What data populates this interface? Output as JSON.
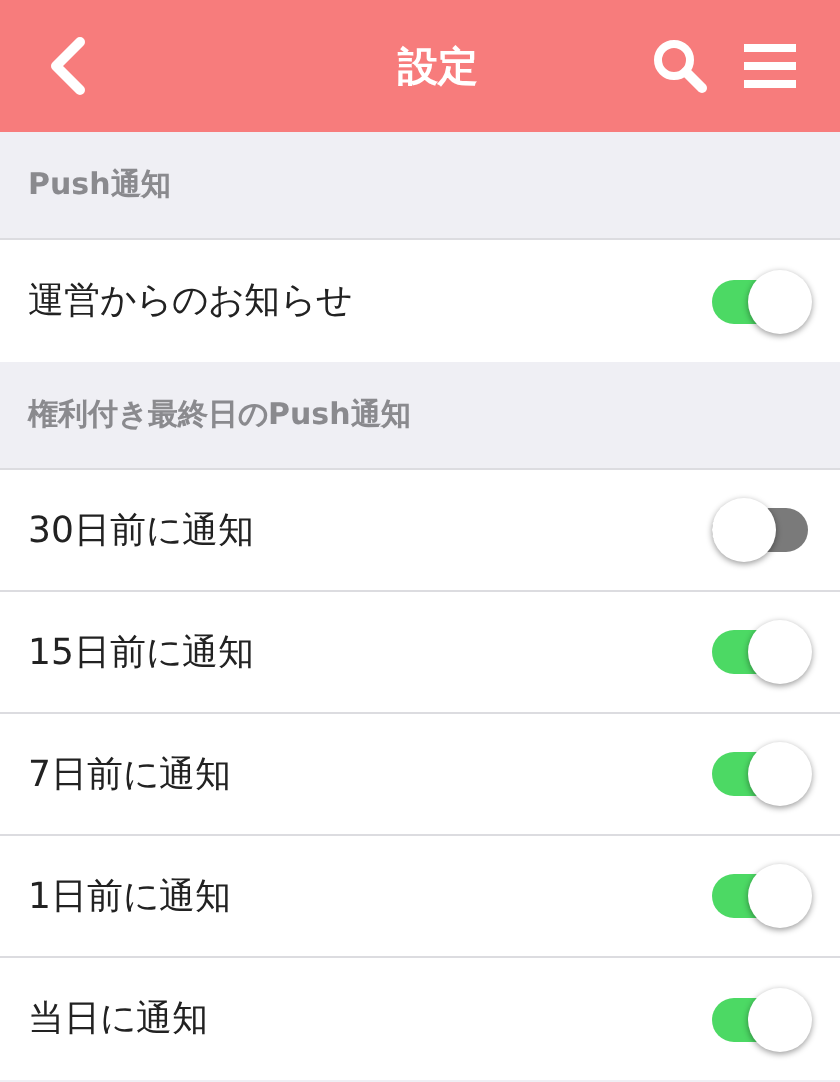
{
  "header": {
    "title": "設定"
  },
  "sections": [
    {
      "title": "Push通知",
      "rows": [
        {
          "label": "運営からのお知らせ",
          "on": true
        }
      ]
    },
    {
      "title": "権利付き最終日のPush通知",
      "rows": [
        {
          "label": "30日前に通知",
          "on": false
        },
        {
          "label": "15日前に通知",
          "on": true
        },
        {
          "label": "7日前に通知",
          "on": true
        },
        {
          "label": "1日前に通知",
          "on": true
        },
        {
          "label": "当日に通知",
          "on": true
        }
      ]
    }
  ]
}
